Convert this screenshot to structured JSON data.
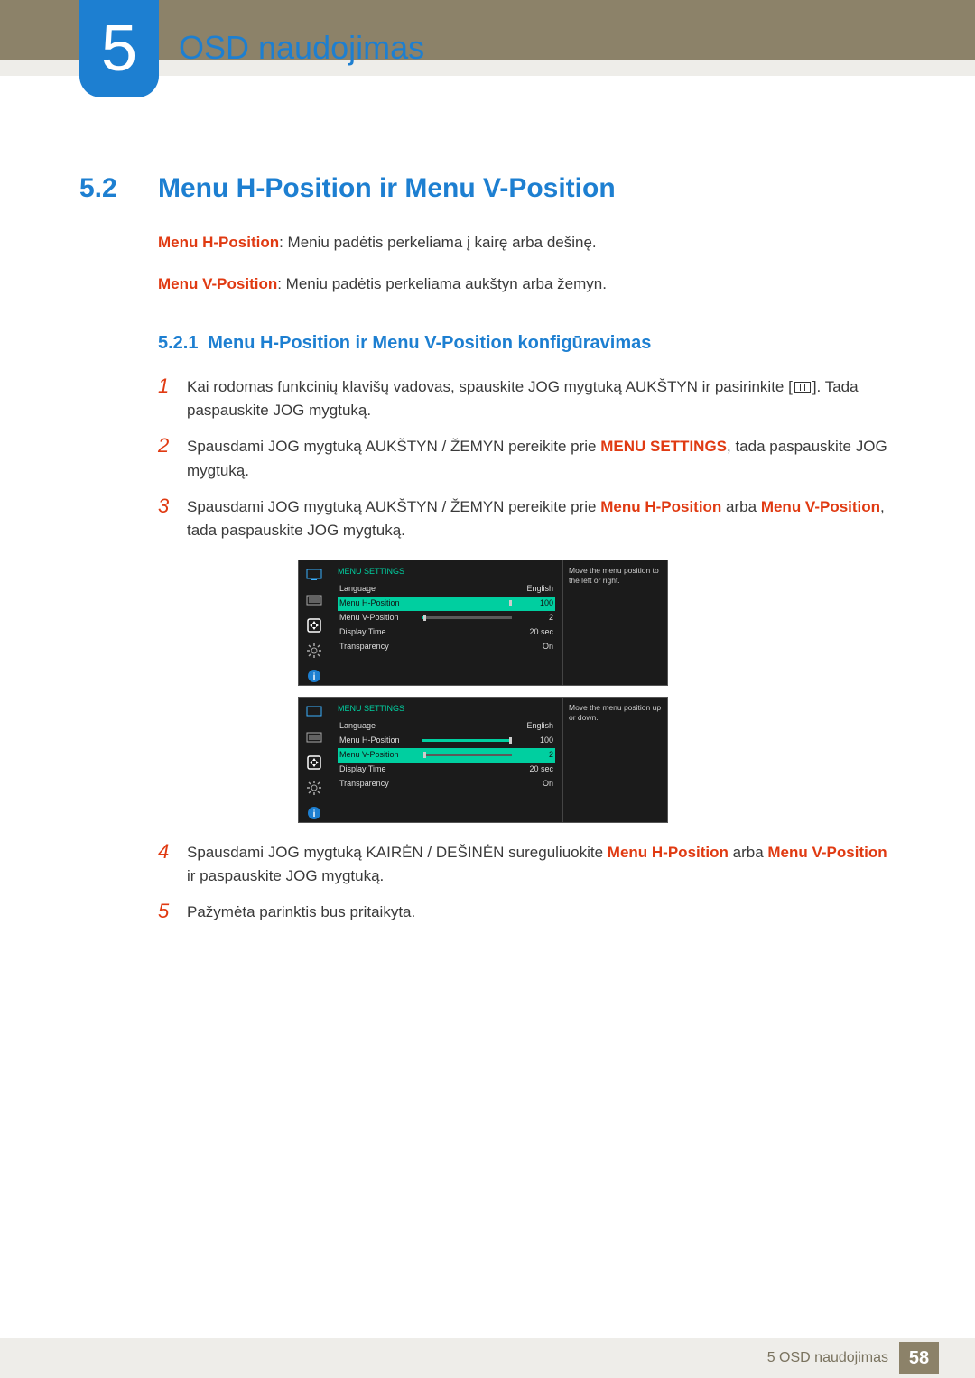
{
  "header": {
    "chapter_number": "5",
    "chapter_title": "OSD naudojimas"
  },
  "section": {
    "number": "5.2",
    "title": "Menu H-Position ir Menu V-Position"
  },
  "intro": {
    "h_label": "Menu H-Position",
    "h_text": ": Meniu padėtis perkeliama į kairę arba dešinę.",
    "v_label": "Menu V-Position",
    "v_text": ": Meniu padėtis perkeliama aukštyn arba žemyn."
  },
  "subsection": {
    "number": "5.2.1",
    "title": "Menu H-Position ir Menu V-Position konfigūravimas"
  },
  "steps": {
    "s1": {
      "n": "1",
      "t1": "Kai rodomas funkcinių klavišų vadovas, spauskite JOG mygtuką AUKŠTYN ir pasirinkite [",
      "t2": "]. Tada paspauskite JOG mygtuką."
    },
    "s2": {
      "n": "2",
      "t1": "Spausdami JOG mygtuką AUKŠTYN / ŽEMYN pereikite prie ",
      "bold": "MENU SETTINGS",
      "t2": ", tada paspauskite JOG mygtuką."
    },
    "s3": {
      "n": "3",
      "t1": "Spausdami JOG mygtuką AUKŠTYN / ŽEMYN pereikite prie ",
      "r1": "Menu H-Position",
      "mid": " arba ",
      "r2": "Menu V-Position",
      "t2": ", tada paspauskite JOG mygtuką."
    },
    "s4": {
      "n": "4",
      "t1": "Spausdami JOG mygtuką KAIRĖN / DEŠINĖN sureguliuokite ",
      "r1": "Menu H-Position",
      "mid": " arba ",
      "r2": "Menu V-Position",
      "t2": " ir paspauskite JOG mygtuką."
    },
    "s5": {
      "n": "5",
      "t": "Pažymėta parinktis bus pritaikyta."
    }
  },
  "osd": {
    "title": "MENU SETTINGS",
    "rows": {
      "language": {
        "label": "Language",
        "value": "English"
      },
      "hpos": {
        "label": "Menu H-Position",
        "value": "100"
      },
      "vpos": {
        "label": "Menu V-Position",
        "value": "2"
      },
      "dtime": {
        "label": "Display Time",
        "value": "20 sec"
      },
      "trans": {
        "label": "Transparency",
        "value": "On"
      }
    },
    "hint_h": "Move the menu position to the left or right.",
    "hint_v": "Move the menu position up or down."
  },
  "footer": {
    "text": "5 OSD naudojimas",
    "page": "58"
  }
}
